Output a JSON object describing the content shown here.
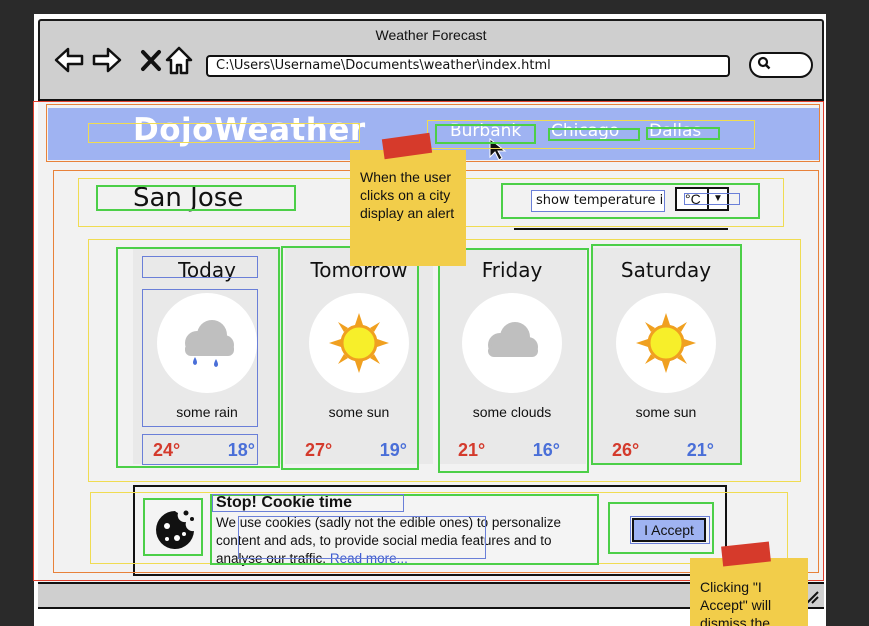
{
  "browser": {
    "title": "Weather Forecast",
    "url": "C:\\Users\\Username\\Documents\\weather\\index.html",
    "icons": [
      "back-arrow-icon",
      "forward-arrow-icon",
      "close-icon",
      "home-icon",
      "search-icon"
    ]
  },
  "header": {
    "logo": "DojoWeather",
    "cities": [
      "Burbank",
      "Chicago",
      "Dallas"
    ]
  },
  "location": {
    "city": "San Jose",
    "temp_label": "show temperature in",
    "unit": "°C"
  },
  "forecast": [
    {
      "day": "Today",
      "icon": "rain-cloud-icon",
      "condition": "some rain",
      "high": "24°",
      "low": "18°"
    },
    {
      "day": "Tomorrow",
      "icon": "sun-icon",
      "condition": "some sun",
      "high": "27°",
      "low": "19°"
    },
    {
      "day": "Friday",
      "icon": "cloud-icon",
      "condition": "some clouds",
      "high": "21°",
      "low": "16°"
    },
    {
      "day": "Saturday",
      "icon": "sun-icon",
      "condition": "some sun",
      "high": "26°",
      "low": "21°"
    }
  ],
  "cookie": {
    "title": "Stop! Cookie time",
    "text": "We use cookies (sadly not the edible ones) to personalize content and ads, to provide social media features and to analyse our traffic.",
    "read_more": "Read more...",
    "accept": "I Accept"
  },
  "notes": {
    "city_click": "When the user clicks on a city display an alert",
    "accept_click": "Clicking \"I Accept\" will dismiss the"
  },
  "colors": {
    "header": "#9fb3f2",
    "high_temp": "#d43a2c",
    "low_temp": "#4a6fd8",
    "sticky": "#f2cd4a",
    "tape": "#d63a2b"
  }
}
